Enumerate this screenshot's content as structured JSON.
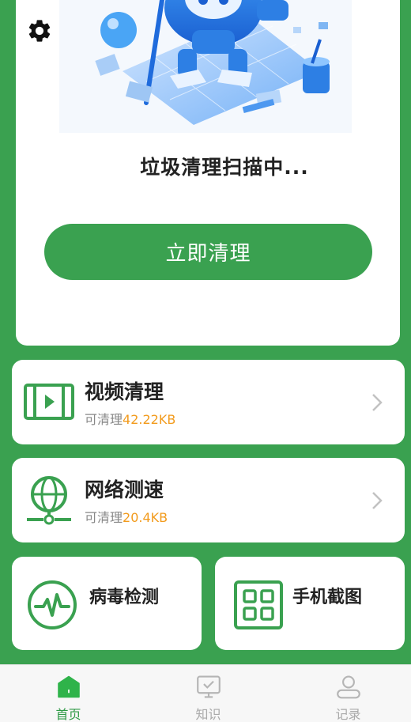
{
  "header": {
    "settings_icon": "gear-icon"
  },
  "hero": {
    "status_text": "垃圾清理扫描中...",
    "clean_button": "立即清理",
    "illustration": "robot-cleaning-illustration"
  },
  "features": [
    {
      "title": "视频清理",
      "sub_label": "可清理",
      "amount": "42.22KB",
      "icon": "video-icon"
    },
    {
      "title": "网络测速",
      "sub_label": "可清理",
      "amount": "20.4KB",
      "icon": "network-globe-icon"
    }
  ],
  "tools": [
    {
      "title": "病毒检测",
      "icon": "pulse-heartbeat-icon"
    },
    {
      "title": "手机截图",
      "icon": "grid-screenshot-icon"
    }
  ],
  "tabbar": {
    "tabs": [
      {
        "label": "首页",
        "icon": "home-icon",
        "active": true
      },
      {
        "label": "知识",
        "icon": "knowledge-board-icon",
        "active": false
      },
      {
        "label": "记录",
        "icon": "user-record-icon",
        "active": false
      }
    ]
  },
  "colors": {
    "brand_green": "#3aa150",
    "amount_orange": "#f29b1d",
    "card_bg": "#ffffff",
    "tab_inactive": "#a9a9a9"
  }
}
